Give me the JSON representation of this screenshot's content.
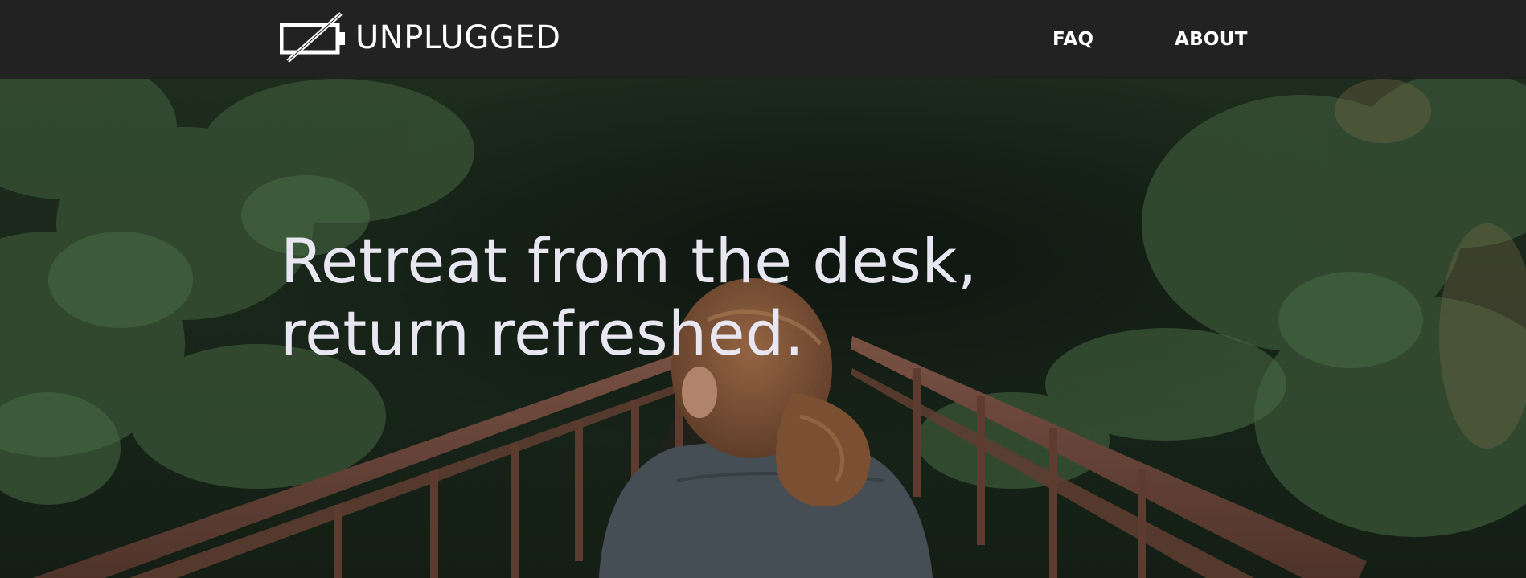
{
  "header": {
    "brand": "UNPLUGGED",
    "logo_icon": "unplugged-battery-icon",
    "nav": [
      {
        "label": "FAQ"
      },
      {
        "label": "ABOUT"
      }
    ]
  },
  "hero": {
    "heading_lines": [
      "Retreat from the desk,",
      "return refreshed."
    ],
    "photo": "woman-on-forest-bridge-photo"
  },
  "colors": {
    "navbar_bg": "#222222",
    "text": "#ffffff",
    "heading_text": "#e8e6f0",
    "forest_dark": "#1f2e1f",
    "bridge_rust": "#6e4a3e"
  }
}
